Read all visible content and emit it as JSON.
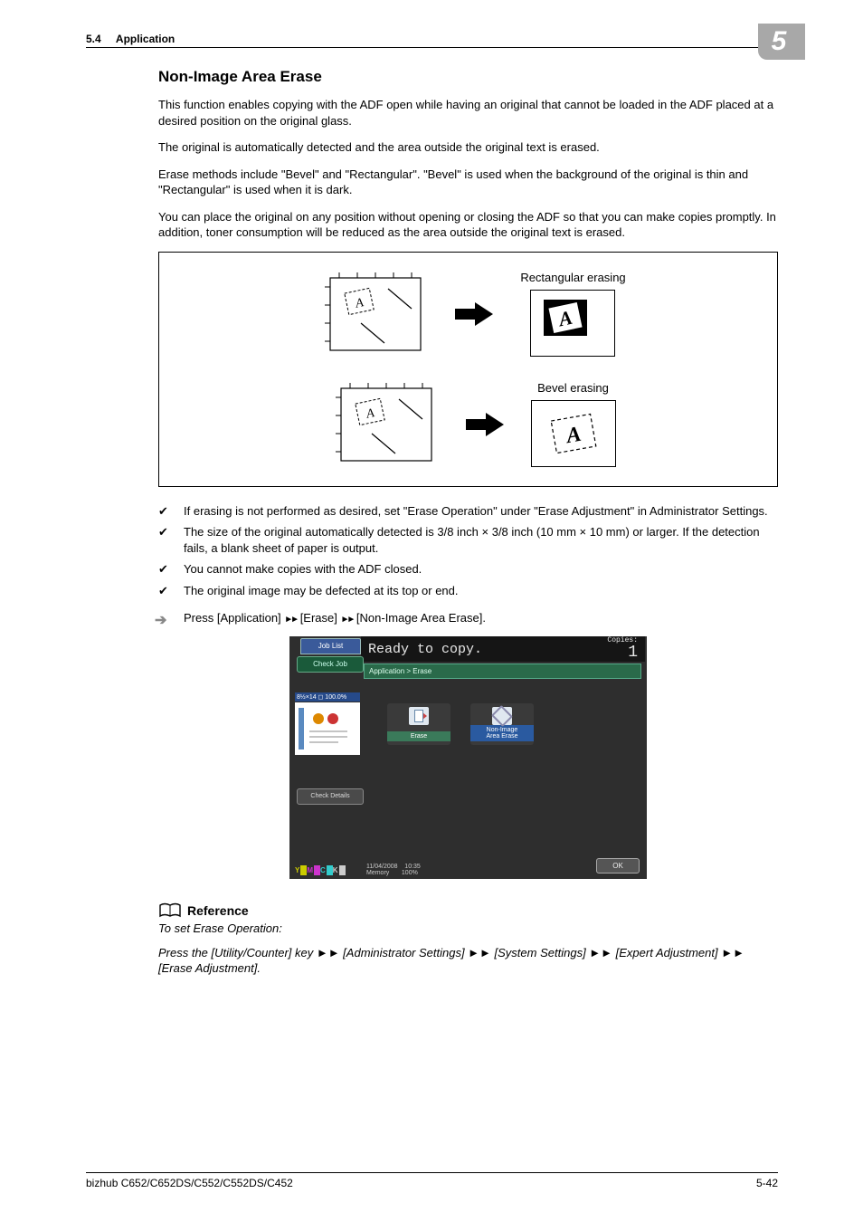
{
  "header": {
    "section_number": "5.4",
    "section_title": "Application",
    "chapter_number": "5"
  },
  "title": "Non-Image Area Erase",
  "paragraphs": {
    "p1": "This function enables copying with the ADF open while having an original that cannot be loaded in the ADF placed at a desired position on the original glass.",
    "p2": "The original is automatically detected and the area outside the original text is erased.",
    "p3": "Erase methods include \"Bevel\" and \"Rectangular\". \"Bevel\" is used when the background of the original is thin and \"Rectangular\" is used when it is dark.",
    "p4": "You can place the original on any position without opening or closing the ADF so that you can make copies promptly. In addition, toner consumption will be reduced as the area outside the original text is erased."
  },
  "diagram": {
    "label_rect": "Rectangular erasing",
    "label_bevel": "Bevel erasing"
  },
  "notes": [
    "If erasing is not performed as desired, set \"Erase Operation\" under \"Erase Adjustment\" in Administrator Settings.",
    "The size of the original automatically detected is 3/8 inch × 3/8 inch (10 mm × 10 mm) or larger. If the detection fails, a blank sheet of paper is output.",
    "You cannot make copies with the ADF closed.",
    "The original image may be defected at its top or end."
  ],
  "instruction": {
    "prefix": "Press [Application] ",
    "step2": " [Erase] ",
    "step3": " [Non-Image Area Erase]."
  },
  "screenshot": {
    "job_list_tab": "Job List",
    "ready": "Ready to copy.",
    "copies_label": "Copies:",
    "copies_value": "1",
    "check_job": "Check Job",
    "breadcrumb": "Application > Erase",
    "preview_header": "8½×14 ◻  100.0%",
    "check_details": "Check Details",
    "btn_erase": "Erase",
    "btn_nonimage": "Non-Image\nArea Erase",
    "toner": {
      "y": "Y",
      "m": "M",
      "c": "C",
      "k": "K"
    },
    "date": "11/04/2008",
    "time": "10:35",
    "memory_label": "Memory",
    "memory_value": "100%",
    "ok": "OK"
  },
  "reference": {
    "heading": "Reference",
    "line1": "To set Erase Operation:",
    "line2": "Press the [Utility/Counter] key ►► [Administrator Settings] ►► [System Settings] ►► [Expert Adjustment] ►► [Erase Adjustment]."
  },
  "footer": {
    "left": "bizhub C652/C652DS/C552/C552DS/C452",
    "right": "5-42"
  }
}
